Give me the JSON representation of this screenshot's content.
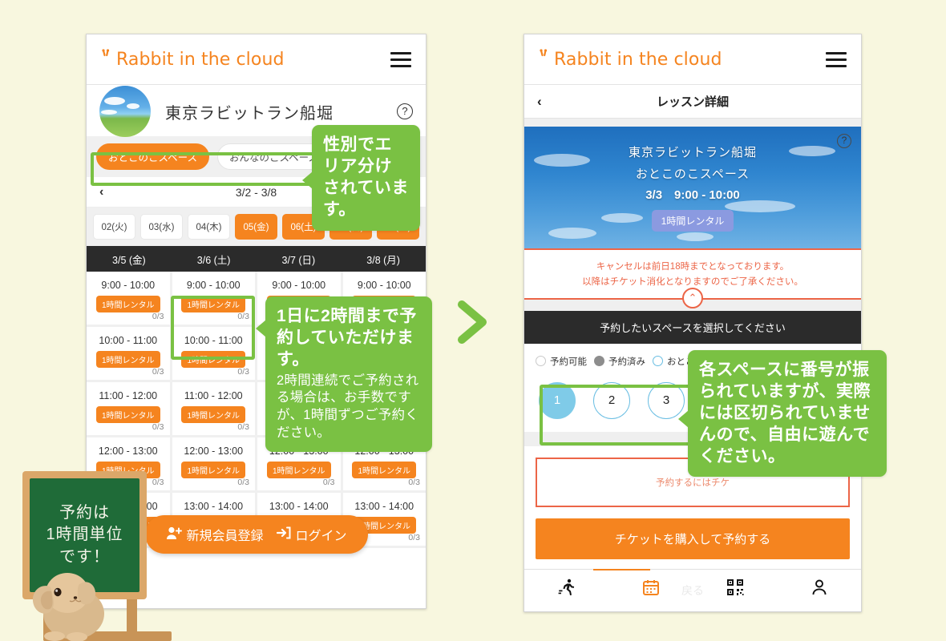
{
  "page": {
    "background_color": "#f8f7df",
    "accent_orange": "#f5841f",
    "accent_green": "#7ac143",
    "accent_red": "#ec6547",
    "accent_blue": "#68bde2"
  },
  "brand": {
    "name": "Rabbit in the cloud",
    "menu_icon": "hamburger-icon"
  },
  "left_phone": {
    "venue": {
      "name": "東京ラビットラン船堀",
      "help_label": "?"
    },
    "space_tabs": [
      {
        "label": "おとこのこスペース",
        "selected": true
      },
      {
        "label": "おんなのこスペース",
        "selected": false
      }
    ],
    "week_nav": {
      "prev": "‹",
      "range": "3/2 - 3/8",
      "next": "›"
    },
    "day_chips": [
      {
        "label": "02(火)",
        "selected": false
      },
      {
        "label": "03(水)",
        "selected": false
      },
      {
        "label": "04(木)",
        "selected": false
      },
      {
        "label": "05(金)",
        "selected": true
      },
      {
        "label": "06(土)",
        "selected": true
      },
      {
        "label": "07(日)",
        "selected": true
      },
      {
        "label": "08(月)",
        "selected": true
      }
    ],
    "grid_columns": [
      "3/5 (金)",
      "3/6 (土)",
      "3/7 (日)",
      "3/8 (月)"
    ],
    "slot_tag": "1時間レンタル",
    "grid_rows": [
      {
        "time": "9:00 - 10:00",
        "capacity": "0/3"
      },
      {
        "time": "10:00 - 11:00",
        "capacity": "0/3"
      },
      {
        "time": "11:00 - 12:00",
        "capacity": "0/3"
      },
      {
        "time": "12:00 - 13:00",
        "capacity": "0/3"
      },
      {
        "time": "13:00 - 14:00",
        "capacity": "0/3"
      }
    ],
    "floating_cta": {
      "signup_label": "新規会員登録",
      "signup_icon": "user-plus-icon",
      "login_label": "ログイン",
      "login_icon": "login-arrow-icon"
    }
  },
  "right_phone": {
    "subheader": {
      "back_icon": "chevron-left-icon",
      "title": "レッスン詳細"
    },
    "hero": {
      "venue": "東京ラビットラン船堀",
      "space": "おとこのこスペース",
      "datetime": "3/3　9:00 - 10:00",
      "tag": "1時間レンタル",
      "help_label": "?"
    },
    "notice": {
      "line1": "キャンセルは前日18時までとなっております。",
      "line2": "以降はチケット消化となりますのでご了承ください。",
      "collapse_icon": "chevron-up-icon"
    },
    "section_title": "予約したいスペースを選択してください",
    "legend": [
      {
        "label": "予約可能",
        "state": "open"
      },
      {
        "label": "予約済み",
        "state": "booked"
      },
      {
        "label": "おとこのこ",
        "state": "selected"
      }
    ],
    "spaces": [
      {
        "number": "1",
        "selected": true
      },
      {
        "number": "2",
        "selected": false
      },
      {
        "number": "3",
        "selected": false
      }
    ],
    "ticket_warning": "予約するにはチケ",
    "buy_button": "チケットを購入して予約する",
    "tabbar": [
      {
        "icon": "running-icon",
        "active": false
      },
      {
        "icon": "calendar-icon",
        "active": true
      },
      {
        "icon": "qr-code-icon",
        "active": false
      },
      {
        "icon": "person-icon",
        "active": false
      }
    ],
    "tabbar_ghost_label": "戻る"
  },
  "callouts": [
    {
      "id": "callout-1",
      "big": "性別でエリア分けされています。",
      "small": ""
    },
    {
      "id": "callout-2",
      "big": "1日に2時間まで予約していただけます。",
      "small": "2時間連続でご予約される場合は、お手数ですが、1時間ずつご予約ください。"
    },
    {
      "id": "callout-3",
      "big": "各スペースに番号が振られていますが、実際には区切られていませんので、自由に遊んでください。",
      "small": ""
    }
  ],
  "chalkboard": {
    "line1": "予約は",
    "line2": "1時間単位",
    "line3": "です！"
  },
  "flow_arrow": "chevron-right-icon"
}
